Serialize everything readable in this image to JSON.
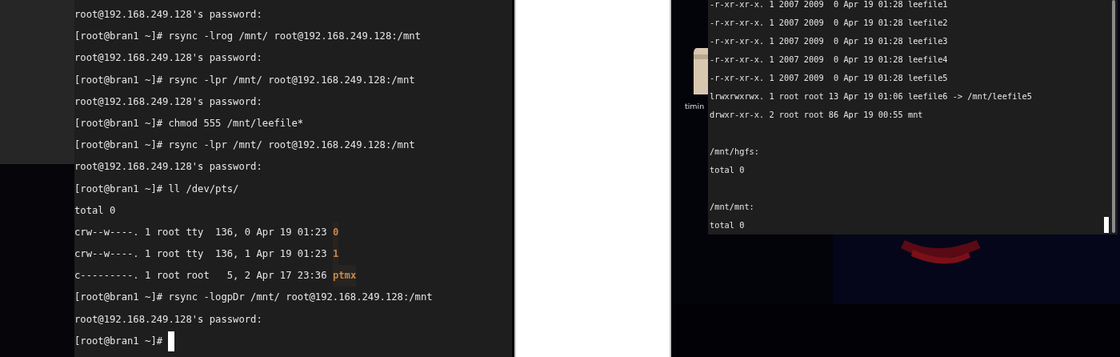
{
  "left_terminal": {
    "lines": [
      {
        "kind": "plain",
        "text": "root@192.168.249.128's password:"
      },
      {
        "kind": "plain",
        "text": "[root@bran1 ~]# rsync -lrog /mnt/ root@192.168.249.128:/mnt"
      },
      {
        "kind": "plain",
        "text": "root@192.168.249.128's password:"
      },
      {
        "kind": "plain",
        "text": "[root@bran1 ~]# rsync -lpr /mnt/ root@192.168.249.128:/mnt"
      },
      {
        "kind": "plain",
        "text": "root@192.168.249.128's password:"
      },
      {
        "kind": "plain",
        "text": "[root@bran1 ~]# chmod 555 /mnt/leefile*"
      },
      {
        "kind": "plain",
        "text": "[root@bran1 ~]# rsync -lpr /mnt/ root@192.168.249.128:/mnt"
      },
      {
        "kind": "plain",
        "text": "root@192.168.249.128's password:"
      },
      {
        "kind": "plain",
        "text": "[root@bran1 ~]# ll /dev/pts/"
      },
      {
        "kind": "plain",
        "text": "total 0"
      },
      {
        "kind": "listing",
        "text": "crw--w----. 1 root tty  136, 0 Apr 19 01:23",
        "name": "0"
      },
      {
        "kind": "listing",
        "text": "crw--w----. 1 root tty  136, 1 Apr 19 01:23",
        "name": "1"
      },
      {
        "kind": "listing",
        "text": "c---------. 1 root root   5, 2 Apr 17 23:36",
        "name": "ptmx"
      },
      {
        "kind": "plain",
        "text": "[root@bran1 ~]# rsync -logpDr /mnt/ root@192.168.249.128:/mnt"
      },
      {
        "kind": "plain",
        "text": "root@192.168.249.128's password:"
      },
      {
        "kind": "prompt",
        "text": "[root@bran1 ~]#"
      }
    ]
  },
  "desktop_icons": [
    {
      "label": "timin"
    }
  ],
  "right_terminal": {
    "lines": [
      {
        "kind": "plain",
        "text": "-r-xr-xr-x. 1 2007 2009  0 Apr 19 01:28 leefile1"
      },
      {
        "kind": "plain",
        "text": "-r-xr-xr-x. 1 2007 2009  0 Apr 19 01:28 leefile2"
      },
      {
        "kind": "plain",
        "text": "-r-xr-xr-x. 1 2007 2009  0 Apr 19 01:28 leefile3"
      },
      {
        "kind": "plain",
        "text": "-r-xr-xr-x. 1 2007 2009  0 Apr 19 01:28 leefile4"
      },
      {
        "kind": "plain",
        "text": "-r-xr-xr-x. 1 2007 2009  0 Apr 19 01:28 leefile5"
      },
      {
        "kind": "plain",
        "text": "lrwxrwxrwx. 1 root root 13 Apr 19 01:06 leefile6 -> /mnt/leefile5"
      },
      {
        "kind": "plain",
        "text": "drwxr-xr-x. 2 root root 86 Apr 19 00:55 mnt"
      },
      {
        "kind": "blank"
      },
      {
        "kind": "plain",
        "text": "/mnt/hgfs:"
      },
      {
        "kind": "plain",
        "text": "total 0"
      },
      {
        "kind": "blank"
      },
      {
        "kind": "plain",
        "text": "/mnt/mnt:"
      },
      {
        "kind": "plain",
        "text": "total 0"
      }
    ]
  }
}
